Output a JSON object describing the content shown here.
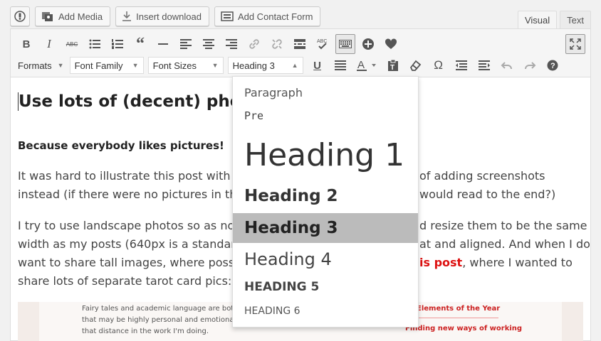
{
  "media_buttons": {
    "add_media": "Add Media",
    "insert_download": "Insert download",
    "add_contact_form": "Add Contact Form"
  },
  "tabs": {
    "visual": "Visual",
    "text": "Text"
  },
  "toolbar": {
    "formats": "Formats",
    "font_family": "Font Family",
    "font_sizes": "Font Sizes",
    "block_format": "Heading 3",
    "strikethrough_glyph": "ABC",
    "omega_glyph": "Ω"
  },
  "content": {
    "heading": "Use lots of (decent) phot",
    "subheading": "Because everybody likes pictures!",
    "p1_line1_a": "It was hard to illustrate this post with ph",
    "p1_line1_b": "of adding screenshots",
    "p1_line2_a": "instead (if there were no pictures in this",
    "p1_line2_b": "would read to the end?)",
    "p2_line1_a": "I try to use landscape photos so as not",
    "p2_line1_b": "d resize them to be the same",
    "p2_line2_a": "width as my posts (640px is a standard",
    "p2_line2_b": "at and aligned. And when I do",
    "p2_line3_a": "want to share tall images, where possib",
    "p2_line3_link": "is post",
    "p2_line3_b": ", where I wanted to",
    "p2_line4": "share lots of separate tarot card pics:",
    "image_text_1": "Fairy tales and academic language are bot",
    "image_text_2": "that may be highly personal and emotiona",
    "image_text_3": "that distance in the work I'm doing.",
    "image_red_1": "Elements of the Year",
    "image_red_2": "Finding new ways of working"
  },
  "dropdown": {
    "items": [
      "Paragraph",
      "Pre",
      "Heading 1",
      "Heading 2",
      "Heading 3",
      "Heading 4",
      "HEADING 5",
      "HEADING 6"
    ],
    "selected": "Heading 3"
  },
  "colors": {
    "link_red": "#d11",
    "selected_bg": "#bbbbbb"
  }
}
